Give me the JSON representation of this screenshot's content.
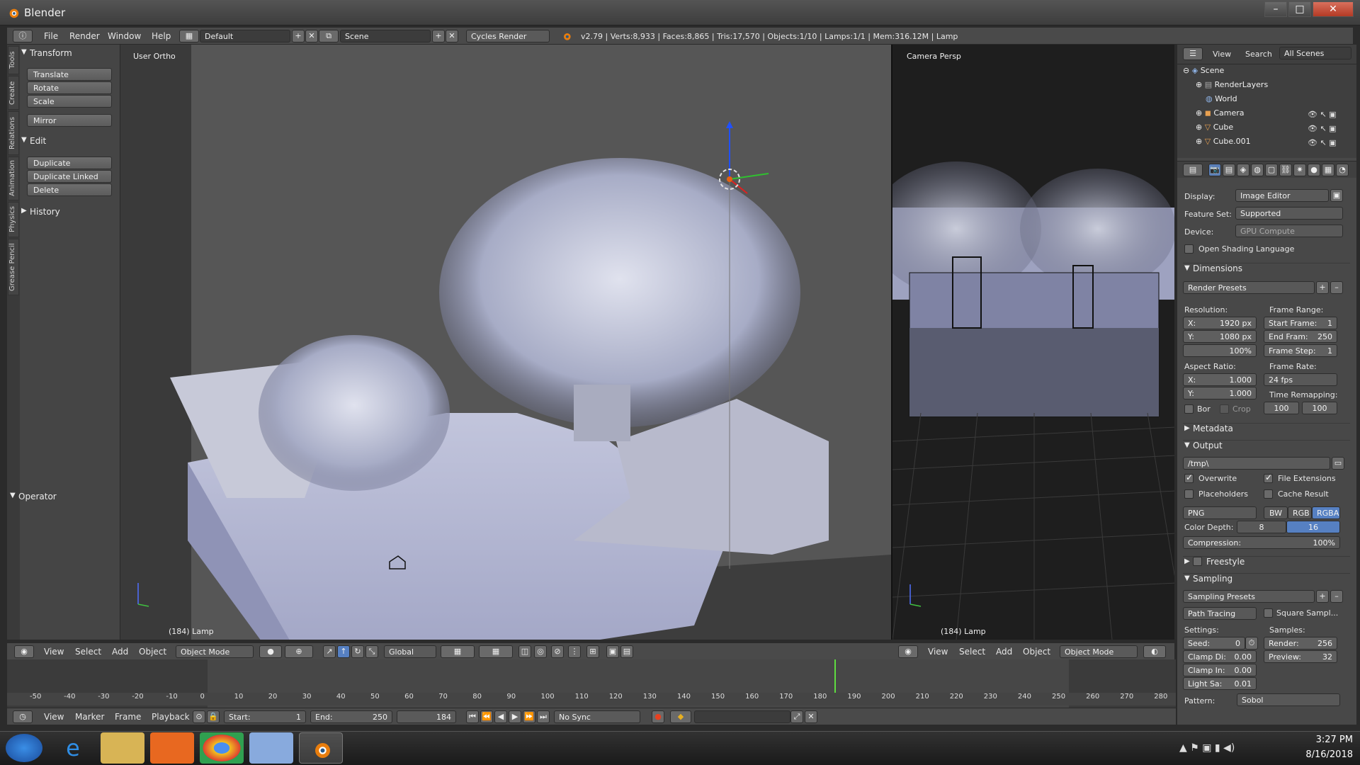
{
  "window": {
    "title": "Blender"
  },
  "menus": [
    "File",
    "Render",
    "Window",
    "Help"
  ],
  "layout": "Default",
  "scene": "Scene",
  "engine": "Cycles Render",
  "stats": "v2.79 | Verts:8,933 | Faces:8,865 | Tris:17,570 | Objects:1/10 | Lamps:1/1 | Mem:316.12M | Lamp",
  "toolshelf": {
    "tabs": [
      "Tools",
      "Create",
      "Relations",
      "Animation",
      "Physics",
      "Grease Pencil"
    ],
    "transform_title": "Transform",
    "transform_buttons": [
      "Translate",
      "Rotate",
      "Scale"
    ],
    "mirror": "Mirror",
    "edit_title": "Edit",
    "edit_buttons": [
      "Duplicate",
      "Duplicate Linked",
      "Delete"
    ],
    "history": "History",
    "operator": "Operator"
  },
  "viewport_left": {
    "label": "User Ortho",
    "status": "(184) Lamp",
    "menu": [
      "View",
      "Select",
      "Add",
      "Object"
    ],
    "mode": "Object Mode",
    "orientation": "Global"
  },
  "viewport_right": {
    "label": "Camera Persp",
    "status": "(184) Lamp",
    "menu": [
      "View",
      "Select",
      "Add",
      "Object"
    ],
    "mode": "Object Mode"
  },
  "outliner": {
    "header": [
      "View",
      "Search",
      "All Scenes"
    ],
    "items": [
      "Scene",
      "RenderLayers",
      "World",
      "Camera",
      "Cube",
      "Cube.001"
    ]
  },
  "props": {
    "display_label": "Display:",
    "display": "Image Editor",
    "feature_label": "Feature Set:",
    "feature": "Supported",
    "device_label": "Device:",
    "device": "GPU Compute",
    "osl": "Open Shading Language",
    "dimensions": "Dimensions",
    "render_presets": "Render Presets",
    "resolution_label": "Resolution:",
    "res_x": "X:",
    "res_x_val": "1920 px",
    "res_y": "Y:",
    "res_y_val": "1080 px",
    "res_pct": "100%",
    "frame_range_label": "Frame Range:",
    "start_frame": "Start Frame:",
    "start_frame_val": "1",
    "end_frame": "End Fram:",
    "end_frame_val": "250",
    "frame_step": "Frame Step:",
    "frame_step_val": "1",
    "aspect_label": "Aspect Ratio:",
    "aspect_x": "X:",
    "aspect_x_val": "1.000",
    "aspect_y": "Y:",
    "aspect_y_val": "1.000",
    "frame_rate_label": "Frame Rate:",
    "frame_rate": "24 fps",
    "time_remap_label": "Time Remapping:",
    "remap_old": "100",
    "remap_new": "100",
    "bor": "Bor",
    "crop": "Crop",
    "metadata": "Metadata",
    "output": "Output",
    "output_path": "/tmp\\",
    "overwrite": "Overwrite",
    "file_ext": "File Extensions",
    "placeholders": "Placeholders",
    "cache_result": "Cache Result",
    "format": "PNG",
    "bw": "BW",
    "rgb": "RGB",
    "rgba": "RGBA",
    "color_depth_label": "Color Depth:",
    "depth8": "8",
    "depth16": "16",
    "compression": "Compression:",
    "compression_val": "100%",
    "freestyle": "Freestyle",
    "sampling": "Sampling",
    "sampling_presets": "Sampling Presets",
    "path_tracing": "Path Tracing",
    "square_samples": "Square Sampl...",
    "settings_label": "Settings:",
    "samples_label": "Samples:",
    "seed": "Seed:",
    "seed_val": "0",
    "render": "Render:",
    "render_val": "256",
    "preview": "Preview:",
    "preview_val": "32",
    "clamp_direct": "Clamp Di:",
    "clamp_direct_val": "0.00",
    "clamp_indirect": "Clamp In:",
    "clamp_indirect_val": "0.00",
    "light_sampling": "Light Sa:",
    "light_sampling_val": "0.01",
    "pattern": "Pattern:",
    "pattern_val": "Sobol"
  },
  "timeline": {
    "ticks": [
      "-50",
      "-40",
      "-30",
      "-20",
      "-10",
      "0",
      "10",
      "20",
      "30",
      "40",
      "50",
      "60",
      "70",
      "80",
      "90",
      "100",
      "110",
      "120",
      "130",
      "140",
      "150",
      "160",
      "170",
      "180",
      "190",
      "200",
      "210",
      "220",
      "230",
      "240",
      "250",
      "260",
      "270",
      "280"
    ],
    "current_frame": 184,
    "menu": [
      "View",
      "Marker",
      "Frame",
      "Playback"
    ],
    "start_label": "Start:",
    "start": "1",
    "end_label": "End:",
    "end": "250",
    "frame": "184",
    "sync": "No Sync"
  },
  "taskbar": {
    "time": "3:27 PM",
    "date": "8/16/2018"
  }
}
